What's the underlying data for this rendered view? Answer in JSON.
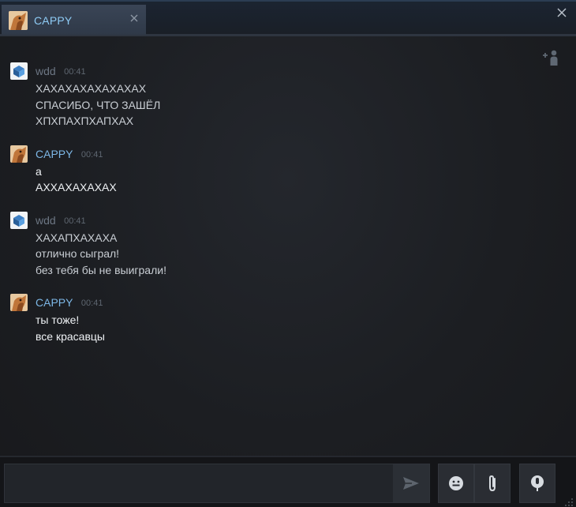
{
  "tab": {
    "name": "CAPPY",
    "close_icon": "close-icon",
    "avatar_icon": "cappy-avatar"
  },
  "window": {
    "close_icon": "window-close-icon",
    "add_friend_icon": "add-friend-icon"
  },
  "messages": [
    {
      "author": "wdd",
      "time": "00:41",
      "lines": [
        "ХАХАХАХАХАХАХАХ",
        "СПАСИБО, ЧТО ЗАШЁЛ",
        "ХПХПАХПХАПХАХ"
      ]
    },
    {
      "author": "CAPPY",
      "time": "00:41",
      "lines": [
        "а",
        "АХХАХАХАХАХ"
      ]
    },
    {
      "author": "wdd",
      "time": "00:41",
      "lines": [
        "ХАХАПХАХАХА",
        "отлично сыграл!",
        "без тебя бы не выиграли!"
      ]
    },
    {
      "author": "CAPPY",
      "time": "00:41",
      "lines": [
        "ты тоже!",
        "все красавцы"
      ]
    }
  ],
  "composer": {
    "input_value": "",
    "send_icon": "send-icon",
    "emoji_icon": "emoji-icon",
    "attach_icon": "paperclip-icon",
    "voice_icon": "microphone-icon"
  },
  "colors": {
    "accent": "#8ecbf5",
    "author_self": "#7db7e6",
    "author_other": "#6c7683"
  }
}
